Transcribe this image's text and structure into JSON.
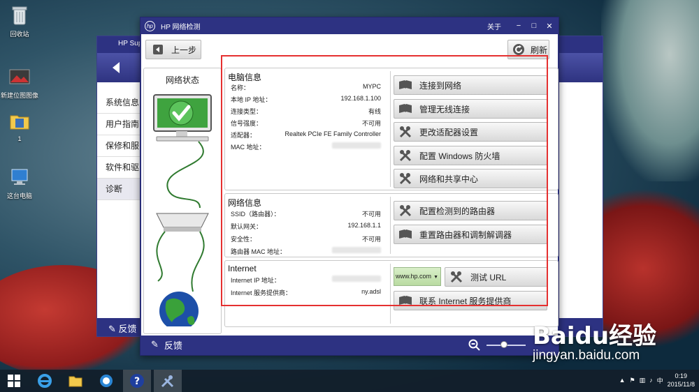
{
  "desktop": {
    "icons": [
      {
        "label": "回收站"
      },
      {
        "label": "新建位图图像"
      },
      {
        "label": "1"
      },
      {
        "label": "这台电脑"
      }
    ]
  },
  "bg_window": {
    "title": "HP Supp",
    "nav": [
      "系统信息",
      "用户指南",
      "保修和服",
      "软件和驱",
      "诊断"
    ],
    "feedback": "反馈"
  },
  "window": {
    "title": "HP 网络检测",
    "about": "关于",
    "controls": {
      "minimize": "−",
      "maximize": "□",
      "close": "✕"
    },
    "back_label": "上一步",
    "refresh_label": "刷新",
    "status_title": "网络状态",
    "feedback_label": "反馈"
  },
  "computer_info": {
    "title": "电脑信息",
    "rows": [
      {
        "label": "名称：",
        "value": "MYPC"
      },
      {
        "label": "本地 IP 地址：",
        "value": "192.168.1.100"
      },
      {
        "label": "连接类型：",
        "value": "有线"
      },
      {
        "label": "信号强度：",
        "value": "不可用"
      },
      {
        "label": "适配器：",
        "value": "Realtek PCIe FE Family Controller"
      },
      {
        "label": "MAC 地址：",
        "value": ""
      }
    ],
    "actions": [
      "连接到网络",
      "管理无线连接",
      "更改适配器设置",
      "配置 Windows 防火墙",
      "网络和共享中心"
    ]
  },
  "network_info": {
    "title": "网络信息",
    "rows": [
      {
        "label": "SSID（路由器）：",
        "value": "不可用"
      },
      {
        "label": "默认网关：",
        "value": "192.168.1.1"
      },
      {
        "label": "安全性：",
        "value": "不可用"
      },
      {
        "label": "路由器 MAC 地址：",
        "value": ""
      }
    ],
    "actions": [
      "配置检测到的路由器",
      "重置路由器和调制解调器"
    ]
  },
  "internet_info": {
    "title": "Internet",
    "rows": [
      {
        "label": "Internet IP 地址：",
        "value": ""
      },
      {
        "label": "Internet 服务提供商：",
        "value": "ny.adsl"
      }
    ],
    "url_select": "www.hp.com",
    "test_url_label": "测试 URL",
    "contact_isp_label": "联系 Internet 服务提供商"
  },
  "taskbar": {
    "time": "0:19",
    "date": "2015/11/8",
    "ime": "中"
  },
  "watermark": {
    "brand": "Baidu经验",
    "url": "jingyan.baidu.com"
  },
  "colors": {
    "hp_blue": "#2d3282",
    "highlight": "#e53030",
    "check_green": "#3aa63a"
  }
}
